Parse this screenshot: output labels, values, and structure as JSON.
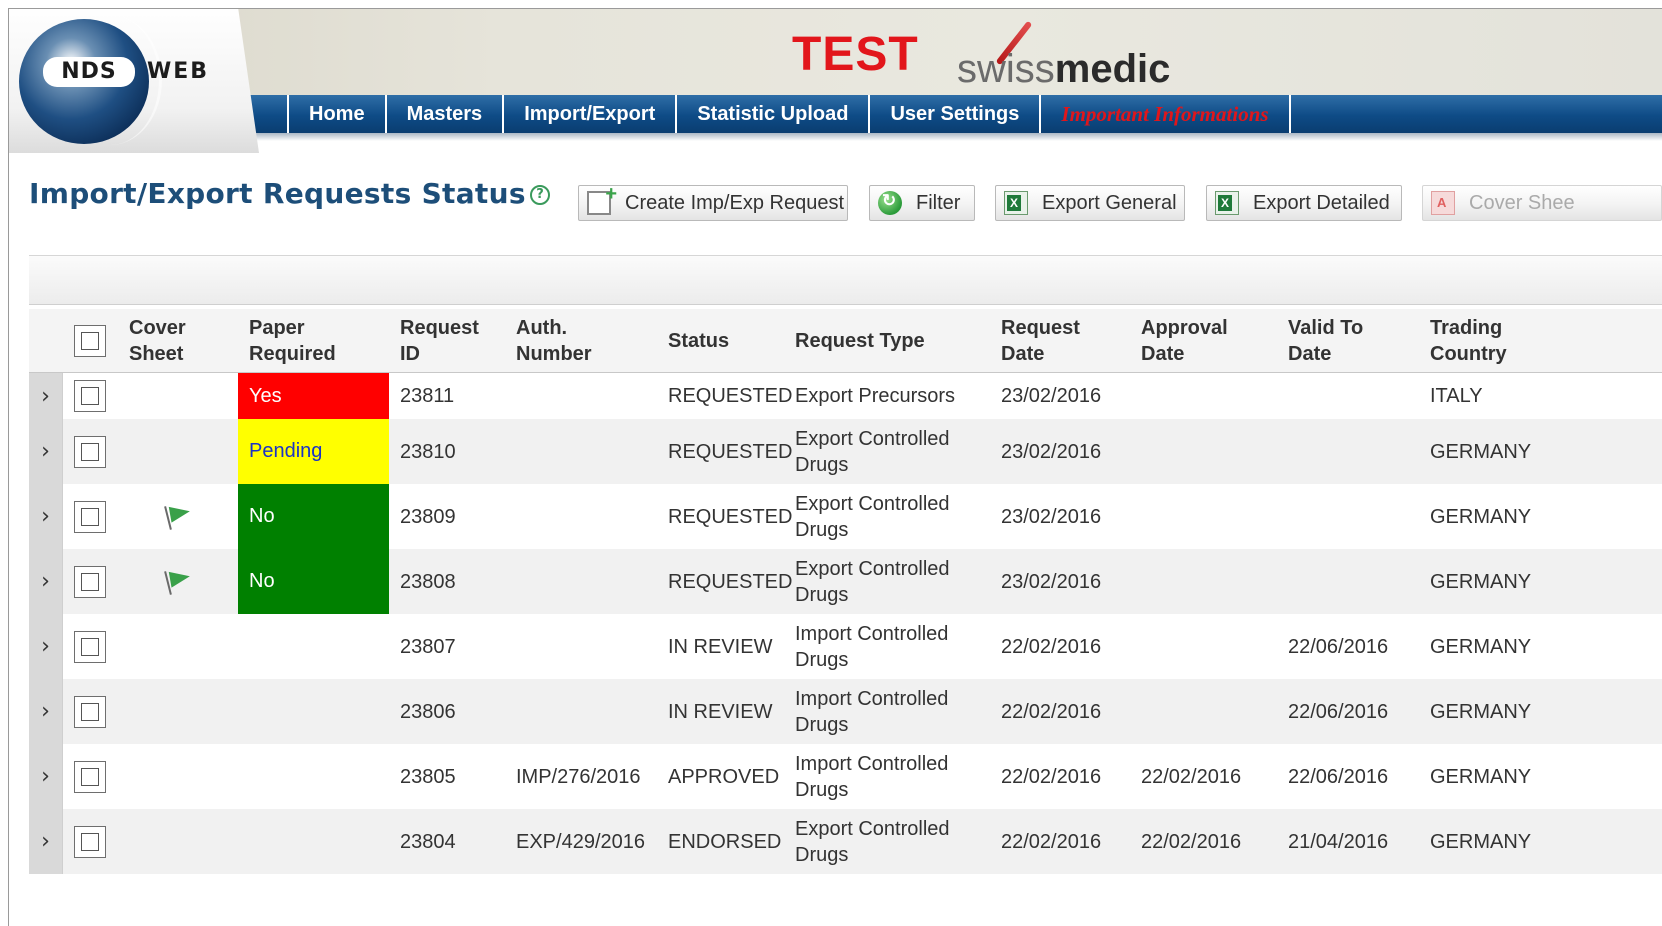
{
  "app": {
    "logo_nds": "NDS",
    "logo_web": "WEB",
    "environment": "TEST",
    "brand_light": "swiss",
    "brand_bold": "medic"
  },
  "nav": {
    "items": [
      {
        "label": "Home"
      },
      {
        "label": "Masters"
      },
      {
        "label": "Import/Export"
      },
      {
        "label": "Statistic Upload"
      },
      {
        "label": "User Settings"
      },
      {
        "label": "Important Informations"
      }
    ]
  },
  "page": {
    "title": "Import/Export Requests Status",
    "help_icon": "question-circle-icon"
  },
  "toolbar": {
    "create_label": "Create Imp/Exp Request",
    "filter_label": "Filter",
    "export_general_label": "Export General",
    "export_detailed_label": "Export Detailed",
    "cover_sheet_label": "Cover Shee"
  },
  "grid": {
    "headers": {
      "cover_1": "Cover",
      "cover_2": "Sheet",
      "paper_1": "Paper",
      "paper_2": "Required",
      "reqid_1": "Request",
      "reqid_2": "ID",
      "auth_1": "Auth.",
      "auth_2": "Number",
      "status": "Status",
      "type": "Request Type",
      "reqdate_1": "Request",
      "reqdate_2": "Date",
      "appdate_1": "Approval",
      "appdate_2": "Date",
      "valid_1": "Valid To",
      "valid_2": "Date",
      "country_1": "Trading",
      "country_2": "Country"
    },
    "rows": [
      {
        "cover_flag": false,
        "paper": "Yes",
        "paper_color": "#ff0000",
        "paper_text_color": "#ffffff",
        "request_id": "23811",
        "auth": "",
        "status": "REQUESTED",
        "type_1": "Export Precursors",
        "type_2": "",
        "request_date": "23/02/2016",
        "approval_date": "",
        "valid_to": "",
        "country": "ITALY"
      },
      {
        "cover_flag": false,
        "paper": "Pending",
        "paper_color": "#ffff00",
        "paper_text_color": "#1a33c8",
        "request_id": "23810",
        "auth": "",
        "status": "REQUESTED",
        "type_1": "Export Controlled",
        "type_2": "Drugs",
        "request_date": "23/02/2016",
        "approval_date": "",
        "valid_to": "",
        "country": "GERMANY"
      },
      {
        "cover_flag": true,
        "paper": "No",
        "paper_color": "#008000",
        "paper_text_color": "#ffffff",
        "request_id": "23809",
        "auth": "",
        "status": "REQUESTED",
        "type_1": "Export Controlled",
        "type_2": "Drugs",
        "request_date": "23/02/2016",
        "approval_date": "",
        "valid_to": "",
        "country": "GERMANY"
      },
      {
        "cover_flag": true,
        "paper": "No",
        "paper_color": "#008000",
        "paper_text_color": "#ffffff",
        "request_id": "23808",
        "auth": "",
        "status": "REQUESTED",
        "type_1": "Export Controlled",
        "type_2": "Drugs",
        "request_date": "23/02/2016",
        "approval_date": "",
        "valid_to": "",
        "country": "GERMANY"
      },
      {
        "cover_flag": false,
        "paper": "",
        "paper_color": "",
        "paper_text_color": "",
        "request_id": "23807",
        "auth": "",
        "status": "IN REVIEW",
        "type_1": "Import Controlled",
        "type_2": "Drugs",
        "request_date": "22/02/2016",
        "approval_date": "",
        "valid_to": "22/06/2016",
        "country": "GERMANY"
      },
      {
        "cover_flag": false,
        "paper": "",
        "paper_color": "",
        "paper_text_color": "",
        "request_id": "23806",
        "auth": "",
        "status": "IN REVIEW",
        "type_1": "Import Controlled",
        "type_2": "Drugs",
        "request_date": "22/02/2016",
        "approval_date": "",
        "valid_to": "22/06/2016",
        "country": "GERMANY"
      },
      {
        "cover_flag": false,
        "paper": "",
        "paper_color": "",
        "paper_text_color": "",
        "request_id": "23805",
        "auth": "IMP/276/2016",
        "status": "APPROVED",
        "type_1": "Import Controlled",
        "type_2": "Drugs",
        "request_date": "22/02/2016",
        "approval_date": "22/02/2016",
        "valid_to": "22/06/2016",
        "country": "GERMANY"
      },
      {
        "cover_flag": false,
        "paper": "",
        "paper_color": "",
        "paper_text_color": "",
        "request_id": "23804",
        "auth": "EXP/429/2016",
        "status": "ENDORSED",
        "type_1": "Export Controlled",
        "type_2": "Drugs",
        "request_date": "22/02/2016",
        "approval_date": "22/02/2016",
        "valid_to": "21/04/2016",
        "country": "GERMANY"
      }
    ]
  }
}
